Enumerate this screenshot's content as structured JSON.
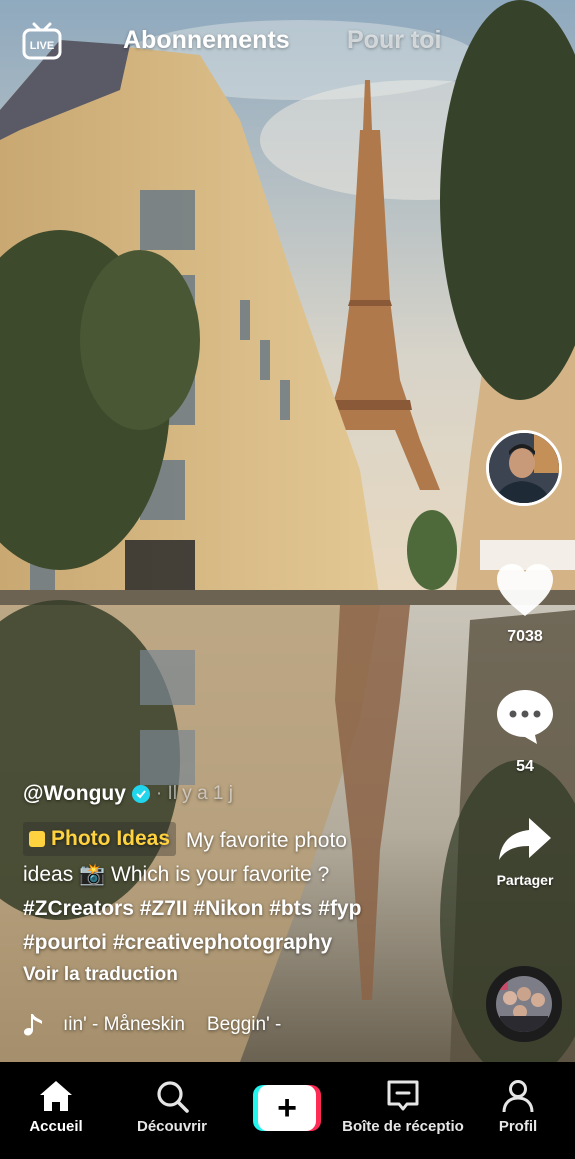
{
  "top_bar": {
    "live_label": "LIVE",
    "tab_following": "Abonnements",
    "tab_for_you": "Pour toi"
  },
  "rail": {
    "likes_count": "7038",
    "comments_count": "54",
    "share_label": "Partager"
  },
  "caption": {
    "author": "@Wonguy",
    "time": "· Il y a 1 j",
    "tag_chip": "Photo Ideas",
    "text_line1": "My favorite photo",
    "text_line2": "ideas 📸 Which is your favorite ?",
    "hashtags_line1": "#ZCreators #Z7II #Nikon #bts #fyp",
    "hashtags_line2": "#pourtoi #creativephotography",
    "translate": "Voir la traduction"
  },
  "music": {
    "track_a": "ıin' - Måneskin",
    "track_b": "Beggin' -"
  },
  "bottom_nav": {
    "home": "Accueil",
    "discover": "Découvrir",
    "create": "+",
    "inbox": "Boîte de réceptio",
    "profile": "Profil"
  },
  "colors": {
    "accent_cyan": "#25f4ee",
    "accent_red": "#fe2c55",
    "chip_yellow": "#ffd23f",
    "verified_blue": "#20d5ec"
  },
  "icons": [
    "live-icon",
    "heart-icon",
    "comment-icon",
    "share-icon",
    "music-note-icon",
    "home-icon",
    "search-icon",
    "plus-icon",
    "inbox-icon",
    "profile-icon"
  ]
}
